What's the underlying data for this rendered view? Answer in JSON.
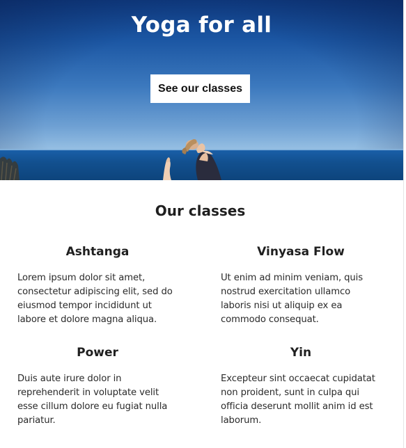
{
  "hero": {
    "title": "Yoga for all",
    "button_label": "See our classes"
  },
  "classes_section": {
    "title": "Our classes",
    "items": [
      {
        "name": "Ashtanga",
        "description": "Lorem ipsum dolor sit amet, consectetur adipiscing elit, sed do eiusmod tempor incididunt ut labore et dolore magna aliqua."
      },
      {
        "name": "Vinyasa Flow",
        "description": "Ut enim ad minim veniam, quis nostrud exercitation ullamco laboris nisi ut aliquip ex ea commodo consequat."
      },
      {
        "name": "Power",
        "description": "Duis aute irure dolor in reprehenderit in voluptate velit esse cillum dolore eu fugiat nulla pariatur."
      },
      {
        "name": "Yin",
        "description": "Excepteur sint occaecat cupidatat non proident, sunt in culpa qui officia deserunt mollit anim id est laborum."
      }
    ]
  }
}
